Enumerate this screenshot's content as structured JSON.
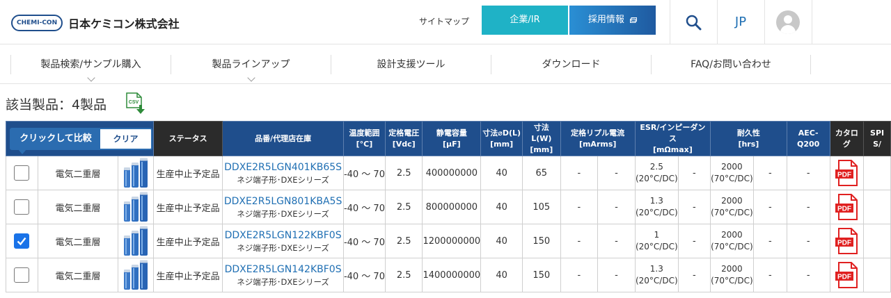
{
  "header": {
    "logo_badge": "CHEMI-CON",
    "company_name": "日本ケミコン株式会社",
    "sitemap_label": "サイトマップ",
    "corp_ir_label": "企業/IR",
    "recruit_label": "採用情報",
    "lang_label": "JP"
  },
  "nav": {
    "items": [
      {
        "label": "製品検索/サンプル購入"
      },
      {
        "label": "製品ラインアップ"
      },
      {
        "label": "設計支援ツール"
      },
      {
        "label": "ダウンロード"
      },
      {
        "label": "FAQ/お問い合わせ"
      }
    ]
  },
  "results": {
    "title": "該当製品：4製品",
    "csv_label": "CSV"
  },
  "compare": {
    "compare_label": "クリックして比較",
    "clear_label": "クリア"
  },
  "table": {
    "headers": {
      "status": "ステータス",
      "part_no": "品番/代理店在庫",
      "temp": "温度範囲",
      "temp_unit": "[°C]",
      "voltage": "定格電圧",
      "voltage_unit": "[Vdc]",
      "capacitance": "静電容量",
      "capacitance_unit": "[μF]",
      "dim_d": "寸法⌀D(L)",
      "dim_d_unit": "[mm]",
      "dim_l": "寸法L(W)",
      "dim_l_unit": "[mm]",
      "ripple": "定格リプル電流",
      "ripple_unit": "[mArms]",
      "esr": "ESR/インピーダンス",
      "esr_unit": "[mΩmax]",
      "endurance": "耐久性",
      "endurance_unit": "[hrs]",
      "aec": "AEC-Q200",
      "catalog": "カタログ",
      "spice": "SPI",
      "spice2": "S/"
    },
    "rows": [
      {
        "checked": false,
        "type": "電気二重層",
        "status": "生産中止予定品",
        "part_no": "DDXE2R5LGN401KB65S",
        "series": "ネジ端子形･DXEシリーズ",
        "temp": "-40 ～ 70",
        "voltage": "2.5",
        "capacitance": "400000000",
        "dim_d": "40",
        "dim_l": "65",
        "ripple1": "-",
        "ripple2": "-",
        "esr_value": "2.5",
        "esr_cond": "(20°C/DC)",
        "esr2": "-",
        "endurance_value": "2000",
        "endurance_cond": "(70°C/DC)",
        "endurance2": "-",
        "aec": "-",
        "pdf": "PDF"
      },
      {
        "checked": false,
        "type": "電気二重層",
        "status": "生産中止予定品",
        "part_no": "DDXE2R5LGN801KBA5S",
        "series": "ネジ端子形･DXEシリーズ",
        "temp": "-40 ～ 70",
        "voltage": "2.5",
        "capacitance": "800000000",
        "dim_d": "40",
        "dim_l": "105",
        "ripple1": "-",
        "ripple2": "-",
        "esr_value": "1.3",
        "esr_cond": "(20°C/DC)",
        "esr2": "-",
        "endurance_value": "2000",
        "endurance_cond": "(70°C/DC)",
        "endurance2": "-",
        "aec": "-",
        "pdf": "PDF"
      },
      {
        "checked": true,
        "type": "電気二重層",
        "status": "生産中止予定品",
        "part_no": "DDXE2R5LGN122KBF0S",
        "series": "ネジ端子形･DXEシリーズ",
        "temp": "-40 ～ 70",
        "voltage": "2.5",
        "capacitance": "1200000000",
        "dim_d": "40",
        "dim_l": "150",
        "ripple1": "-",
        "ripple2": "-",
        "esr_value": "1",
        "esr_cond": "(20°C/DC)",
        "esr2": "-",
        "endurance_value": "2000",
        "endurance_cond": "(70°C/DC)",
        "endurance2": "-",
        "aec": "-",
        "pdf": "PDF"
      },
      {
        "checked": false,
        "type": "電気二重層",
        "status": "生産中止予定品",
        "part_no": "DDXE2R5LGN142KBF0S",
        "series": "ネジ端子形･DXEシリーズ",
        "temp": "-40 ～ 70",
        "voltage": "2.5",
        "capacitance": "1400000000",
        "dim_d": "40",
        "dim_l": "150",
        "ripple1": "-",
        "ripple2": "-",
        "esr_value": "1.3",
        "esr_cond": "(20°C/DC)",
        "esr2": "-",
        "endurance_value": "2000",
        "endurance_cond": "(70°C/DC)",
        "endurance2": "-",
        "aec": "-",
        "pdf": "PDF"
      }
    ]
  },
  "colors": {
    "header_blue": "#1f4e8c",
    "corp_button": "#1fb2c6",
    "link_blue": "#1f6fb3",
    "pdf_red": "#e02020",
    "checkbox_on": "#1a73e8"
  },
  "icons": [
    "search-icon",
    "avatar-icon",
    "chevron-down-icon",
    "csv-download-icon",
    "external-link-icon",
    "pdf-icon",
    "capacitor-image"
  ]
}
